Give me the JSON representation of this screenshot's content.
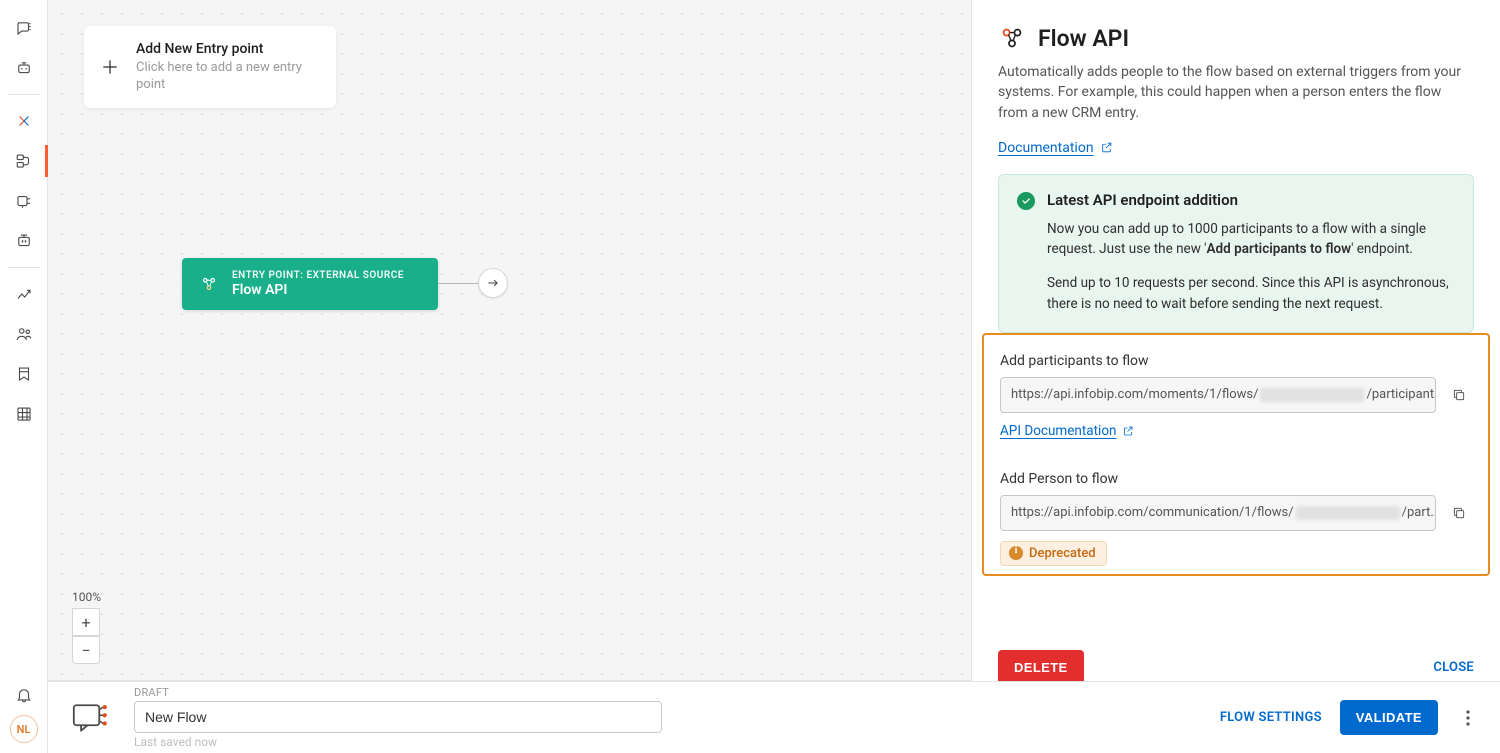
{
  "sidebar": {
    "avatar": "NL"
  },
  "canvas": {
    "add_entry": {
      "title": "Add New Entry point",
      "subtitle": "Click here to add a new entry point"
    },
    "node": {
      "eyebrow": "ENTRY POINT: EXTERNAL SOURCE",
      "name": "Flow API"
    },
    "zoom": "100%"
  },
  "bottom": {
    "draft_label": "DRAFT",
    "name_value": "New Flow",
    "saved_label": "Last saved now",
    "settings_label": "FLOW SETTINGS",
    "validate_label": "VALIDATE"
  },
  "panel": {
    "title": "Flow API",
    "description": "Automatically adds people to the flow based on external triggers from your systems. For example, this could happen when a person enters the flow from a new CRM entry.",
    "doc_link_label": "Documentation",
    "callout": {
      "title": "Latest API endpoint addition",
      "p1a": "Now you can add up to 1000 participants to a flow with a single request. Just use the new '",
      "p1b_strong": "Add participants to flow",
      "p1c": "' endpoint.",
      "p2": "Send up to 10 requests per second. Since this API is asynchronous, there is no need to wait before sending the next request."
    },
    "ep1": {
      "label": "Add participants to flow",
      "url_pre": "https://api.infobip.com/moments/1/flows/",
      "url_post": "/participants",
      "doc_link": "API Documentation"
    },
    "ep2": {
      "label": "Add Person to flow",
      "url_pre": "https://api.infobip.com/communication/1/flows/",
      "url_post": "/part...",
      "deprecated_label": "Deprecated"
    },
    "delete_label": "DELETE",
    "close_label": "CLOSE"
  }
}
